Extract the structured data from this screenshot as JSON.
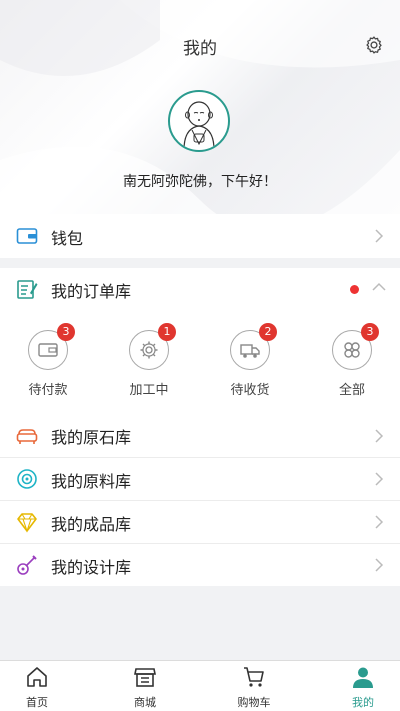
{
  "header": {
    "title": "我的",
    "greeting": "南无阿弥陀佛，下午好！"
  },
  "wallet": {
    "label": "钱包"
  },
  "orders": {
    "label": "我的订单库",
    "statuses": [
      {
        "label": "待付款",
        "count": "3"
      },
      {
        "label": "加工中",
        "count": "1"
      },
      {
        "label": "待收货",
        "count": "2"
      },
      {
        "label": "全部",
        "count": "3"
      }
    ]
  },
  "libraries": [
    {
      "label": "我的原石库"
    },
    {
      "label": "我的原料库"
    },
    {
      "label": "我的成品库"
    },
    {
      "label": "我的设计库"
    }
  ],
  "tabbar": [
    {
      "label": "首页"
    },
    {
      "label": "商城"
    },
    {
      "label": "购物车"
    },
    {
      "label": "我的"
    }
  ],
  "colors": {
    "accent": "#2a9b8e",
    "badge": "#e0362f"
  }
}
